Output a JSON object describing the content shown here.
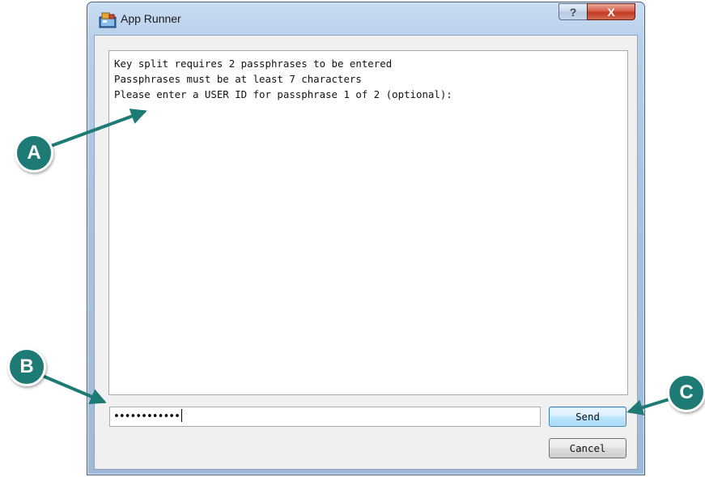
{
  "window": {
    "title": "App Runner",
    "help_label": "?",
    "close_label": "X"
  },
  "output": {
    "lines": [
      "Key split requires 2 passphrases to be entered",
      "Passphrases must be at least 7 characters",
      "Please enter a USER ID for passphrase 1 of 2 (optional):"
    ]
  },
  "input": {
    "value": "••••••••••••"
  },
  "buttons": {
    "send": "Send",
    "cancel": "Cancel"
  },
  "callouts": {
    "a": "A",
    "b": "B",
    "c": "C"
  },
  "colors": {
    "callout": "#1e7a74",
    "send_border": "#3c7fb1"
  }
}
